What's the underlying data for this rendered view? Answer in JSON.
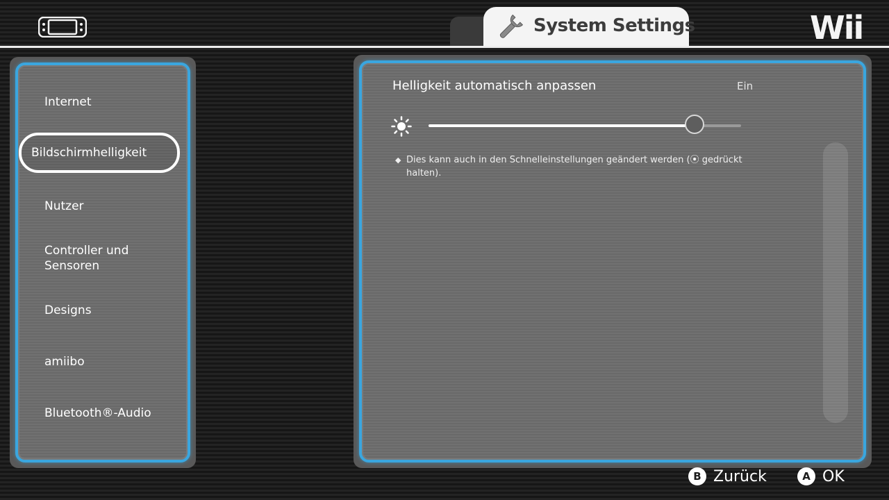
{
  "header": {
    "tab_title": "System Settings",
    "logo_text": "Wii",
    "console_icon": "handheld-console-icon",
    "tab_icon": "wrench-icon"
  },
  "sidebar": {
    "items": [
      {
        "label": "Internet",
        "selected": false
      },
      {
        "label": "Bildschirmhelligkeit",
        "selected": true
      },
      {
        "label": "Nutzer",
        "selected": false
      },
      {
        "label": "Controller und Sensoren",
        "selected": false
      },
      {
        "label": "Designs",
        "selected": false
      },
      {
        "label": "amiibo",
        "selected": false
      },
      {
        "label": "Bluetooth®-Audio",
        "selected": false
      }
    ]
  },
  "content": {
    "auto_brightness_label": "Helligkeit automatisch anpassen",
    "auto_brightness_value": "Ein",
    "brightness_icon": "sun-icon",
    "brightness_level": 0.85,
    "hint_bullet": "◆",
    "hint_text": "Dies kann auch in den Schnelleinstellungen geändert werden (⦿ gedrückt halten)."
  },
  "footer": {
    "back_glyph": "B",
    "back_label": "Zurück",
    "ok_glyph": "A",
    "ok_label": "OK"
  },
  "colors": {
    "accent": "#3aa6df",
    "panel": "#6c6c6c",
    "background": "#1a1a1a"
  }
}
